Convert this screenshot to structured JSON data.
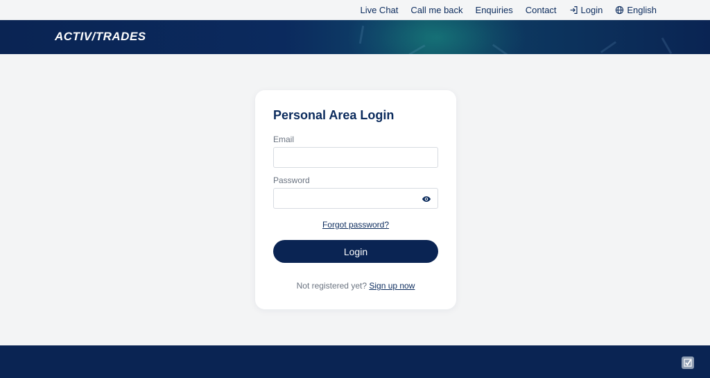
{
  "topnav": {
    "live_chat": "Live Chat",
    "call_me_back": "Call me back",
    "enquiries": "Enquiries",
    "contact": "Contact",
    "login": "Login",
    "language": "English",
    "login_icon": "login-icon",
    "language_icon": "globe-icon"
  },
  "brand": {
    "logo_part1": "Activ",
    "logo_part2": "Trades",
    "primary_color": "#0a2453"
  },
  "login_card": {
    "title": "Personal Area Login",
    "email_label": "Email",
    "email_value": "",
    "password_label": "Password",
    "password_value": "",
    "password_toggle_icon": "eye-icon",
    "forgot_link": "Forgot password?",
    "submit_label": "Login",
    "signup_prompt": "Not registered yet?",
    "signup_link": "Sign up now"
  },
  "footer": {
    "badge_icon": "checkmark-badge-icon"
  }
}
